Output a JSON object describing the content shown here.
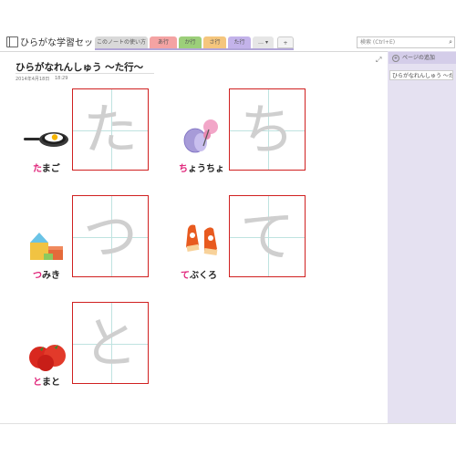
{
  "notebook": {
    "title": "ひらがな学習セット ▾"
  },
  "tabs": [
    {
      "label": "このノートの使い方",
      "color": "#d9d9d9"
    },
    {
      "label": "あ行",
      "color": "#f4a3a3"
    },
    {
      "label": "か行",
      "color": "#9ccf7a"
    },
    {
      "label": "さ行",
      "color": "#f5c67d"
    },
    {
      "label": "た行",
      "color": "#c3b3ea"
    },
    {
      "label": "… ▾",
      "color": "#e6e6e6"
    },
    {
      "label": "+",
      "color": "#f3f3f3"
    }
  ],
  "search": {
    "placeholder": "検索 (Ctrl+E)"
  },
  "pane": {
    "add_page": "ページの追加",
    "pages": [
      "ひらがなれんしゅう ～た行～"
    ]
  },
  "page": {
    "title": "ひらがなれんしゅう ～た行～",
    "date": "2014年4月18日",
    "time": "18:29"
  },
  "cards": [
    {
      "char": "た",
      "highlight": "た",
      "rest": "まご",
      "icon": "frying-pan-egg-icon"
    },
    {
      "char": "ち",
      "highlight": "ち",
      "rest": "ょうちょ",
      "icon": "butterfly-icon"
    },
    {
      "char": "つ",
      "highlight": "つ",
      "rest": "みき",
      "icon": "building-blocks-icon"
    },
    {
      "char": "て",
      "highlight": "て",
      "rest": "ぶくろ",
      "icon": "mittens-icon"
    },
    {
      "char": "と",
      "highlight": "と",
      "rest": "まと",
      "icon": "tomato-icon"
    }
  ]
}
